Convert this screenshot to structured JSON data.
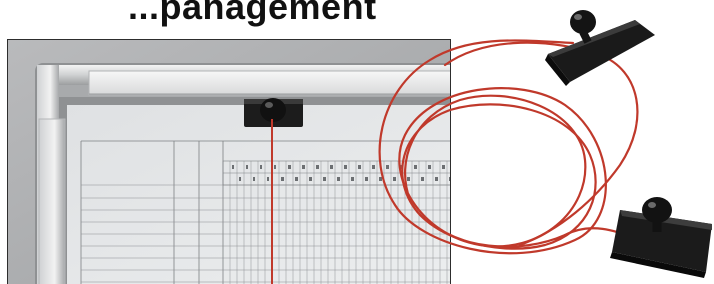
{
  "headline": {
    "text": "...panagement"
  },
  "product": {
    "components": [
      {
        "name": "board-frame",
        "icon": "planning-board"
      },
      {
        "name": "magnetic-holder-mounted",
        "icon": "magnet-holder"
      },
      {
        "name": "magnetic-holder-loose-top",
        "icon": "magnet-holder"
      },
      {
        "name": "magnetic-holder-loose-bottom",
        "icon": "magnet-holder"
      },
      {
        "name": "red-cord",
        "icon": "cord"
      }
    ],
    "colors": {
      "cord": "#c0392b",
      "holder": "#1b1b1b",
      "frame": "#a9acae",
      "board": "#e4e6e8",
      "background": "#ffffff"
    }
  }
}
